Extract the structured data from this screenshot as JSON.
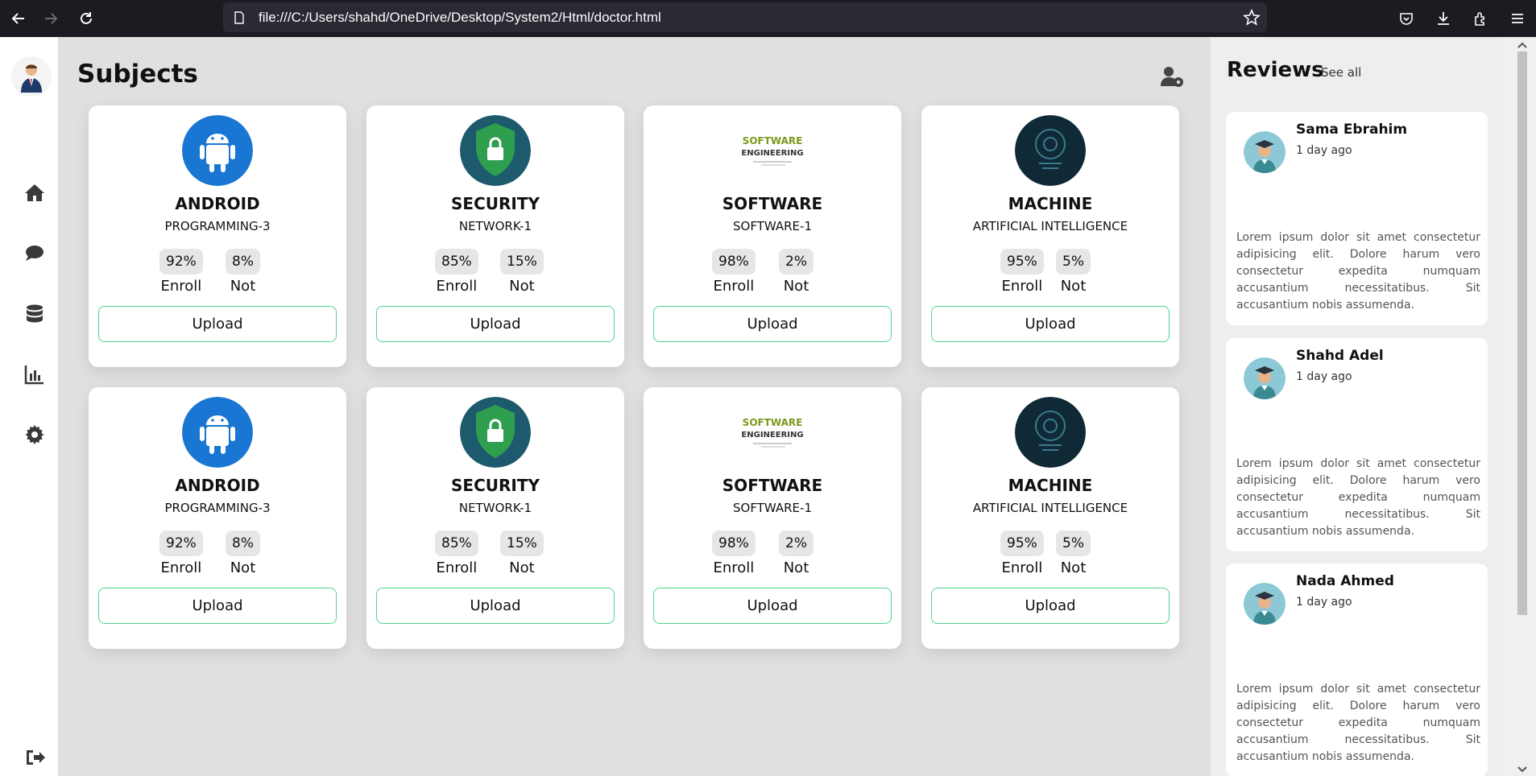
{
  "browser": {
    "url": "file:///C:/Users/shahd/OneDrive/Desktop/System2/Html/doctor.html"
  },
  "sidebar": {
    "items": [
      {
        "name": "home-icon"
      },
      {
        "name": "chat-icon"
      },
      {
        "name": "database-icon"
      },
      {
        "name": "chart-icon"
      },
      {
        "name": "gear-icon"
      }
    ],
    "logout": "logout-icon"
  },
  "main": {
    "title": "Subjects",
    "upload_label": "Upload",
    "enroll_label": "Enroll",
    "not_label": "Not",
    "cards": [
      {
        "title": "ANDROID",
        "subtitle": "PROGRAMMING-3",
        "enroll": "92%",
        "not": "8%",
        "icon": "android-icon"
      },
      {
        "title": "SECURITY",
        "subtitle": "NETWORK-1",
        "enroll": "85%",
        "not": "15%",
        "icon": "security-shield-icon"
      },
      {
        "title": "SOFTWARE",
        "subtitle": "SOFTWARE-1",
        "enroll": "98%",
        "not": "2%",
        "icon": "software-engineering-icon"
      },
      {
        "title": "MACHINE",
        "subtitle": "ARTIFICIAL INTELLIGENCE",
        "enroll": "95%",
        "not": "5%",
        "icon": "machine-learning-icon"
      },
      {
        "title": "ANDROID",
        "subtitle": "PROGRAMMING-3",
        "enroll": "92%",
        "not": "8%",
        "icon": "android-icon"
      },
      {
        "title": "SECURITY",
        "subtitle": "NETWORK-1",
        "enroll": "85%",
        "not": "15%",
        "icon": "security-shield-icon"
      },
      {
        "title": "SOFTWARE",
        "subtitle": "SOFTWARE-1",
        "enroll": "98%",
        "not": "2%",
        "icon": "software-engineering-icon"
      },
      {
        "title": "MACHINE",
        "subtitle": "ARTIFICIAL INTELLIGENCE",
        "enroll": "95%",
        "not": "5%",
        "icon": "machine-learning-icon"
      }
    ]
  },
  "reviews": {
    "title": "Reviews",
    "see_all": "See all",
    "items": [
      {
        "name": "Sama Ebrahim",
        "time": "1 day ago",
        "body": "Lorem ipsum dolor sit amet consectetur adipisicing elit. Dolore harum vero consectetur expedita numquam accusantium necessitatibus. Sit accusantium nobis assumenda."
      },
      {
        "name": "Shahd Adel",
        "time": "1 day ago",
        "body": "Lorem ipsum dolor sit amet consectetur adipisicing elit. Dolore harum vero consectetur expedita numquam accusantium necessitatibus. Sit accusantium nobis assumenda."
      },
      {
        "name": "Nada Ahmed",
        "time": "1 day ago",
        "body": "Lorem ipsum dolor sit amet consectetur adipisicing elit. Dolore harum vero consectetur expedita numquam accusantium necessitatibus. Sit accusantium nobis assumenda."
      }
    ]
  },
  "colors": {
    "upload_border": "#4fd58f",
    "android_blue": "#1976d2",
    "security_green": "#2e9e4f",
    "ml_dark": "#0f2a36"
  }
}
